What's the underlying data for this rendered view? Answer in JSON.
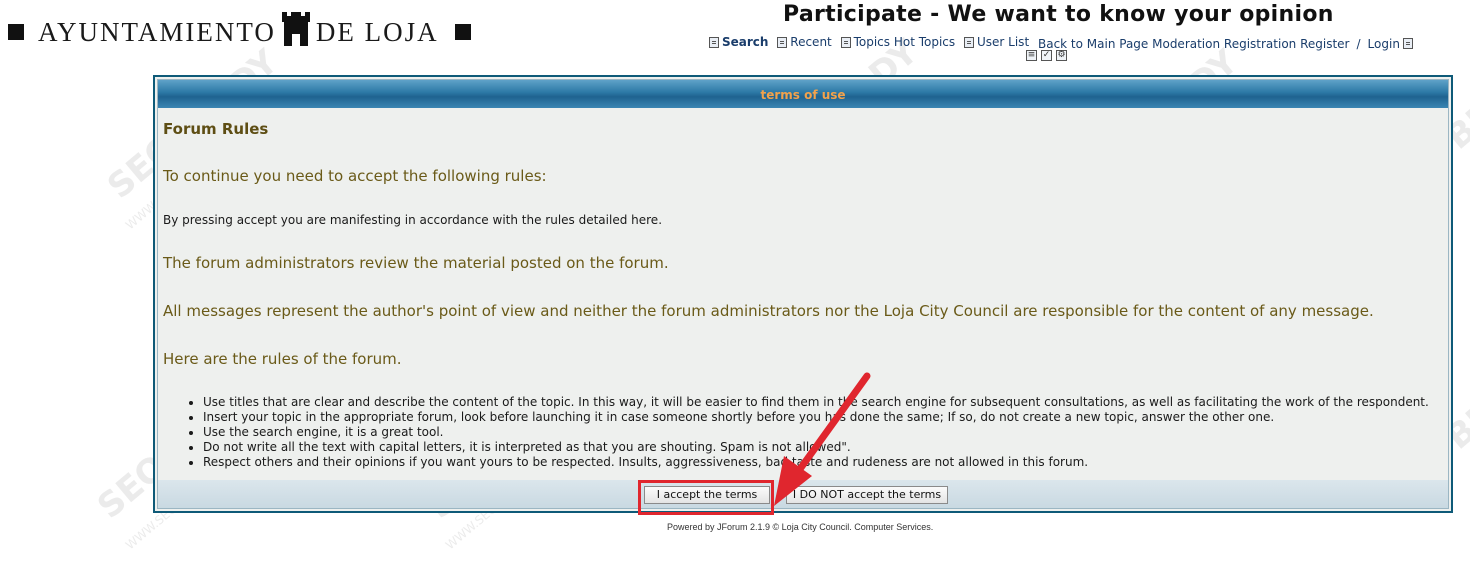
{
  "logo": {
    "part1": "AYUNTAMIENTO",
    "part2": "DE LOJA"
  },
  "site_title": "Participate - We want to know your opinion",
  "nav": {
    "search": "Search",
    "recent": "Recent",
    "topics": "Topics Hot Topics",
    "user_list": "User List",
    "main_page": "Back to Main Page Moderation Registration Register",
    "slash": "/",
    "login": "Login"
  },
  "panel": {
    "header": "terms of use",
    "rules_title": "Forum Rules",
    "intro": "To continue you need to accept the following rules:",
    "accept_note": "By pressing accept you are manifesting in accordance with the rules detailed here.",
    "review": "The forum administrators review the material posted on the forum.",
    "disclaimer": "All messages represent the author's point of view and neither the forum administrators nor the Loja City Council are responsible for the content of any message.",
    "rules_intro": "Here are the rules of the forum.",
    "rules": [
      "Use titles that are clear and describe the content of the topic. In this way, it will be easier to find them in the search engine for subsequent consultations, as well as facilitating the work of the respondent.",
      "Insert your topic in the appropriate forum, look before launching it in case someone shortly before you has done the same; If so, do not create a new topic, answer the other one.",
      "Use the search engine, it is a great tool.",
      "Do not write all the text with capital letters, it is interpreted as that you are shouting. Spam is not allowed\".",
      "Respect others and their opinions if you want yours to be respected. Insults, aggressiveness, bad taste and rudeness are not allowed in this forum."
    ],
    "accept_button": "I accept the terms",
    "decline_button": "I DO NOT accept the terms"
  },
  "footer": "Powered by JForum 2.1.9 © Loja City Council. Computer Services.",
  "watermark": {
    "brand": "SEOBUDDY",
    "url": "WWW.SEOBUDDY.COM"
  },
  "colors": {
    "header_bar": "#2b78a5",
    "header_text": "#f2a24c",
    "panel_border": "#0e5a78",
    "body_text": "#6a5a18",
    "highlight": "#e0262e"
  }
}
